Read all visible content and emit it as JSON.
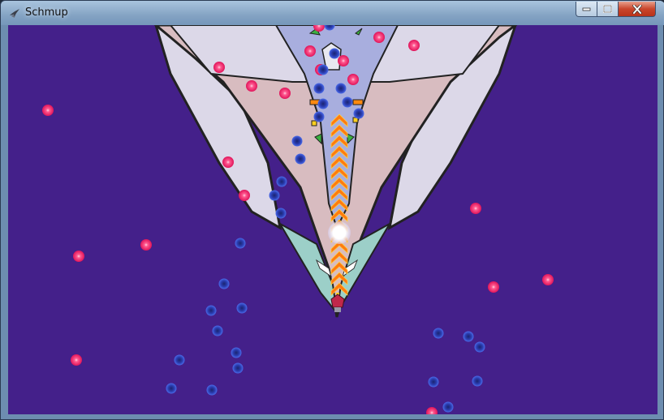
{
  "window": {
    "title": "Schmup",
    "app_icon": "bird-icon",
    "controls": [
      "minimize-icon",
      "maximize-icon",
      "close-icon"
    ]
  },
  "scene": {
    "background_color": "#44208a",
    "enemy_bullet_color": "#ee2a6a",
    "player_bullet_color": "#2c3eb8",
    "player_laser_color": "#ff7a10",
    "boss_body_color": "#d8bcc0",
    "boss_wing_color": "#dcd8e8",
    "boss_cockpit_color": "#a8aede"
  }
}
